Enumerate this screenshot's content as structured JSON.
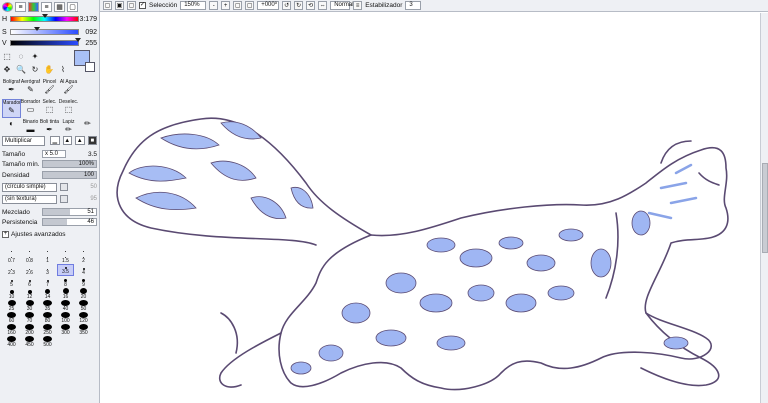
{
  "color_panel": {
    "sliders": [
      {
        "label": "H",
        "value": "3:179",
        "pos": 0.49
      },
      {
        "label": "S",
        "value": "092",
        "pos": 0.36
      },
      {
        "label": "V",
        "value": "255",
        "pos": 1.0
      }
    ],
    "primary_color": "#a8c0f6",
    "secondary_color": "#ffffff"
  },
  "brushes": {
    "items": [
      {
        "label": "Bolígraf",
        "icon": "✒"
      },
      {
        "label": "Aerógraf",
        "icon": "✎"
      },
      {
        "label": "Pincel",
        "icon": "🖌"
      },
      {
        "label": "Al Agua",
        "icon": "🖌"
      },
      {
        "label": "",
        "icon": ""
      },
      {
        "label": "Marador",
        "icon": "✎",
        "selected": true
      },
      {
        "label": "Borrador",
        "icon": "▭"
      },
      {
        "label": "Selec.",
        "icon": "⬚"
      },
      {
        "label": "Deselec.",
        "icon": "⬚"
      },
      {
        "label": "",
        "icon": ""
      },
      {
        "label": "",
        "icon": "◐"
      },
      {
        "label": "Binario",
        "icon": "▬"
      },
      {
        "label": "Boli tinta",
        "icon": "✒"
      },
      {
        "label": "Lapiz",
        "icon": "✏"
      },
      {
        "label": "",
        "icon": "✏"
      }
    ],
    "blend_mode": "Multiplicar"
  },
  "properties": {
    "tamano_label": "Tamaño",
    "tamano_mult": "x 5.0",
    "tamano_value": "3.5",
    "tamano_min_label": "Tamaño mín.",
    "tamano_min_value": "100%",
    "densidad_label": "Densidad",
    "densidad_value": "100",
    "shape_label": "(círculo simple)",
    "shape_value": "50",
    "texture_label": "(sin textura)",
    "texture_value": "95",
    "mezclado_label": "Mezclado",
    "mezclado_value": "51",
    "persistencia_label": "Persistencia",
    "persistencia_value": "46",
    "advanced_label": "Ajustes avanzados"
  },
  "brush_sizes": [
    {
      "v": "",
      "d": 1
    },
    {
      "v": "",
      "d": 1
    },
    {
      "v": "",
      "d": 1
    },
    {
      "v": "",
      "d": 1
    },
    {
      "v": "",
      "d": 1
    },
    {
      "v": "0.7",
      "d": 1
    },
    {
      "v": "0.8",
      "d": 1
    },
    {
      "v": "1",
      "d": 1
    },
    {
      "v": "1.5",
      "d": 1
    },
    {
      "v": "2",
      "d": 1
    },
    {
      "v": "2.3",
      "d": 1
    },
    {
      "v": "2.6",
      "d": 1
    },
    {
      "v": "3",
      "d": 1
    },
    {
      "v": "3.5",
      "d": 2,
      "sel": true
    },
    {
      "v": "4",
      "d": 2
    },
    {
      "v": "5",
      "d": 2
    },
    {
      "v": "6",
      "d": 2
    },
    {
      "v": "7",
      "d": 2
    },
    {
      "v": "8",
      "d": 3
    },
    {
      "v": "9",
      "d": 3
    },
    {
      "v": "10",
      "d": 4
    },
    {
      "v": "12",
      "d": 4
    },
    {
      "v": "14",
      "d": 5
    },
    {
      "v": "16",
      "d": 6
    },
    {
      "v": "20",
      "d": 7
    },
    {
      "v": "25",
      "d": 8
    },
    {
      "v": "30",
      "d": 8
    },
    {
      "v": "35",
      "d": 9
    },
    {
      "v": "40",
      "d": 9
    },
    {
      "v": "50",
      "d": 9
    },
    {
      "v": "60",
      "d": 9
    },
    {
      "v": "70",
      "d": 9
    },
    {
      "v": "80",
      "d": 9
    },
    {
      "v": "100",
      "d": 9
    },
    {
      "v": "120",
      "d": 9
    },
    {
      "v": "160",
      "d": 9
    },
    {
      "v": "200",
      "d": 9
    },
    {
      "v": "250",
      "d": 9
    },
    {
      "v": "300",
      "d": 9
    },
    {
      "v": "350",
      "d": 9
    },
    {
      "v": "400",
      "d": 9
    },
    {
      "v": "450",
      "d": 9
    },
    {
      "v": "500",
      "d": 9
    }
  ],
  "toolbar": {
    "selection_label": "Selección",
    "zoom": "150%",
    "rotation": "+000º",
    "mode": "Normal",
    "stabilizer_label": "Estabilizador",
    "stabilizer_value": "3"
  },
  "colors": {
    "panel_bg": "#eef0f4",
    "line_color": "#5a4a72",
    "fill_blue": "#9fb6f3",
    "fill_light": "#cdd9fa"
  }
}
